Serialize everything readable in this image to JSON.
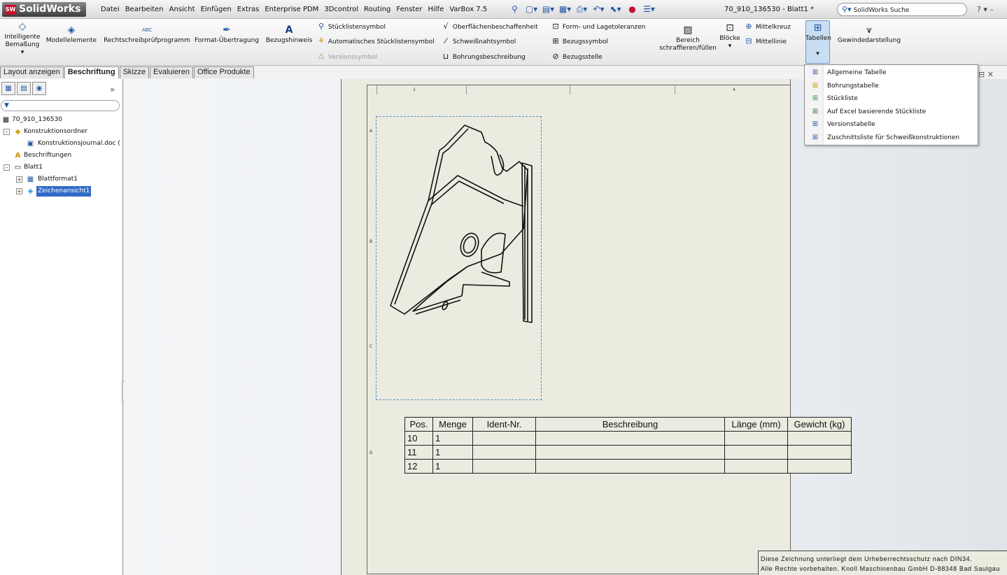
{
  "app": {
    "logo": "SolidWorks",
    "logo_mark": "SW",
    "doc_title": "70_910_136530 - Blatt1 *",
    "search_placeholder": "SolidWorks Suche",
    "window_controls": "? ▾ –"
  },
  "menubar": [
    "Datei",
    "Bearbeiten",
    "Ansicht",
    "Einfügen",
    "Extras",
    "Enterprise PDM",
    "3Dcontrol",
    "Routing",
    "Fenster",
    "Hilfe",
    "VarBox 7.5"
  ],
  "quick_access": [
    {
      "icon": "pin-icon",
      "glyph": "⚲"
    },
    {
      "icon": "new-document-icon",
      "glyph": "▢▾"
    },
    {
      "icon": "open-folder-icon",
      "glyph": "▤▾"
    },
    {
      "icon": "save-icon",
      "glyph": "▦▾"
    },
    {
      "icon": "print-icon",
      "glyph": "⎙▾"
    },
    {
      "icon": "undo-icon",
      "glyph": "↶▾"
    },
    {
      "icon": "select-arrow-icon",
      "glyph": "⬉▾"
    },
    {
      "icon": "traffic-light-icon",
      "glyph": "●"
    },
    {
      "icon": "options-icon",
      "glyph": "☰▾"
    }
  ],
  "ribbon": {
    "intelligente": {
      "label1": "Intelligente",
      "label2": "Bemaßung",
      "caret": "▾"
    },
    "modellelemente": "Modellelemente",
    "rechtschreib": "Rechtschreibprüfprogramm",
    "format": "Format-Übertragung",
    "bezugshinweis": "Bezugshinweis",
    "stuecklistensymbol": "Stücklistensymbol",
    "auto_stueckliste": "Automatisches Stücklistensymbol",
    "versionssymbol": "Versionssymbol",
    "oberflaeche": "Oberflächenbeschaffenheit",
    "schweissnaht": "Schweißnahtsymbol",
    "bohrung": "Bohrungsbeschreibung",
    "form_lage": "Form- und Lagetoleranzen",
    "bezugssymbol": "Bezugssymbol",
    "bezugsstelle": "Bezugsstelle",
    "bereich1": "Bereich",
    "bereich2": "schraffieren/füllen",
    "bloecke": "Blöcke",
    "mittelkreuz": "Mittelkreuz",
    "mittellinie": "Mittellinie",
    "tabellen": "Tabellen",
    "gewinde": "Gewindedarstellung",
    "spell_glyph": "ABC"
  },
  "tabs": [
    "Layout anzeigen",
    "Beschriftung",
    "Skizze",
    "Evaluieren",
    "Office Produkte"
  ],
  "tabs_active": "Beschriftung",
  "feature_tree": {
    "more": "»",
    "items": [
      {
        "label": "70_910_136530",
        "indent": 0
      },
      {
        "label": "Konstruktionsordner",
        "indent": 1
      },
      {
        "label": "Konstruktionsjournal.doc (",
        "indent": 2
      },
      {
        "label": "Beschriftungen",
        "indent": 1
      },
      {
        "label": "Blatt1",
        "indent": 1
      },
      {
        "label": "Blattformat1",
        "indent": 2
      },
      {
        "label": "Zeichenansicht1",
        "indent": 2
      }
    ]
  },
  "sheet": {
    "zones_top": [
      "1",
      "4"
    ],
    "zones_left": [
      "A",
      "B",
      "C",
      "D"
    ],
    "hud_icons": [
      "zoom-fit-icon",
      "zoom-area-icon",
      "previous-view-icon",
      "rotate-icon",
      "pan-icon",
      "display-style-icon",
      "view-settings-icon"
    ]
  },
  "bom": {
    "headers": [
      "Pos.",
      "Menge",
      "Ident-Nr.",
      "Beschreibung",
      "Länge (mm)",
      "Gewicht (kg)"
    ],
    "rows": [
      [
        "10",
        "1",
        "",
        "",
        "",
        ""
      ],
      [
        "11",
        "1",
        "",
        "",
        "",
        ""
      ],
      [
        "12",
        "1",
        "",
        "",
        "",
        ""
      ]
    ]
  },
  "copyright": {
    "line1": "Diese Zeichnung unterliegt dem Urheberrechtsschutz nach DIN34.",
    "line2": "Alle Rechte vorbehalten. Knoll Maschinenbau GmbH D-88348 Bad Saulgau"
  },
  "tables_dropdown": [
    "Allgemeine Tabelle",
    "Bohrungstabelle",
    "Stückliste",
    "Auf Excel basierende Stückliste",
    "Versionstabelle",
    "Zuschnittsliste für Schweißkonstruktionen"
  ],
  "colors": {
    "accent": "#2458a6",
    "selection": "#316ac5",
    "sheet": "#ecebe0",
    "view_border": "#4a8fd0"
  }
}
